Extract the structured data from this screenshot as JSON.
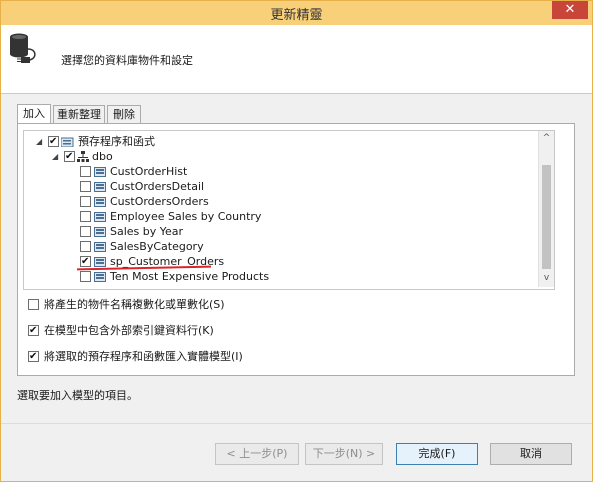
{
  "window": {
    "title": "更新精靈",
    "close_glyph": "✕"
  },
  "header": {
    "text": "選擇您的資料庫物件和設定"
  },
  "tabs": [
    {
      "label": "加入",
      "active": true
    },
    {
      "label": "重新整理",
      "active": false
    },
    {
      "label": "刪除",
      "active": false
    }
  ],
  "tree": {
    "root": {
      "label": "預存程序和函式",
      "checked": true,
      "expander": "◢"
    },
    "schema": {
      "label": "dbo",
      "checked": true,
      "expander": "◢"
    },
    "items": [
      {
        "label": "CustOrderHist",
        "checked": false
      },
      {
        "label": "CustOrdersDetail",
        "checked": false
      },
      {
        "label": "CustOrdersOrders",
        "checked": false
      },
      {
        "label": "Employee Sales by Country",
        "checked": false
      },
      {
        "label": "Sales by Year",
        "checked": false
      },
      {
        "label": "SalesByCategory",
        "checked": false
      },
      {
        "label": "sp_Customer_Orders",
        "checked": true
      },
      {
        "label": "Ten Most Expensive Products",
        "checked": false
      }
    ],
    "scroll_up_glyph": "^",
    "scroll_down_glyph": "v"
  },
  "options": [
    {
      "label": "將產生的物件名稱複數化或單數化(S)",
      "checked": false
    },
    {
      "label": "在模型中包含外部索引鍵資料行(K)",
      "checked": true
    },
    {
      "label": "將選取的預存程序和函數匯入實體模型(I)",
      "checked": true
    }
  ],
  "status_text": "選取要加入模型的項目。",
  "buttons": {
    "back": "< 上一步(P)",
    "next": "下一步(N) >",
    "finish": "完成(F)",
    "cancel": "取消"
  },
  "colors": {
    "title_bar": "#f9d07a",
    "close": "#c8453a",
    "annotation_underline": "#d8262a",
    "primary_border": "#3c7fb1"
  },
  "icons": [
    "database-connect-icon",
    "stored-procedure-icon",
    "schema-icon",
    "procedure-folder-icon"
  ]
}
